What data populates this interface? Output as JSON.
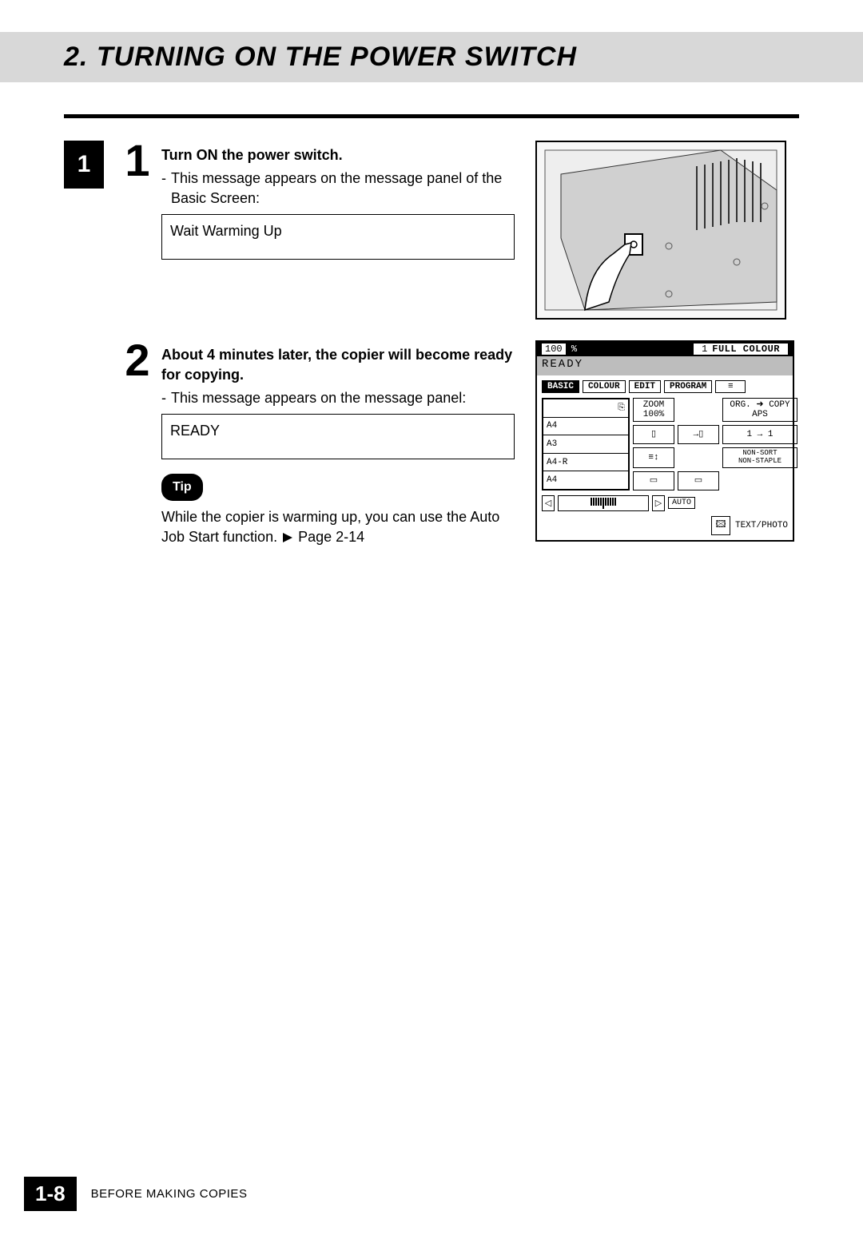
{
  "header": {
    "section_number": "2.",
    "title": "TURNING ON THE POWER SWITCH"
  },
  "side_tab": "1",
  "steps": [
    {
      "num": "1",
      "heading": "Turn ON the power switch.",
      "bullet": "This message appears on the message panel of the Basic Screen:",
      "message": "Wait  Warming Up"
    },
    {
      "num": "2",
      "heading": "About 4 minutes later, the copier will become ready for copying.",
      "bullet": "This message appears on the message panel:",
      "message": "READY"
    }
  ],
  "tip": {
    "label": "Tip",
    "text_before": "While the copier is warming up, you can use the Auto Job Start function.",
    "page_ref": "Page 2-14"
  },
  "lcd": {
    "percent": "100",
    "percent_sym": "%",
    "count": "1",
    "mode": "FULL COLOUR",
    "ready": "READY",
    "tabs": [
      "BASIC",
      "COLOUR",
      "EDIT",
      "PROGRAM"
    ],
    "papers": [
      "",
      "A4",
      "A3",
      "A4-R",
      "A4"
    ],
    "zoom_label": "ZOOM",
    "zoom_value": "100%",
    "orgcopy": "ORG. ➜ COPY",
    "aps": "APS",
    "ratio": "1 → 1",
    "nonsort": "NON-SORT",
    "nonstaple": "NON-STAPLE",
    "auto": "AUTO",
    "textphoto": "TEXT/PHOTO"
  },
  "footer": {
    "page": "1-8",
    "label": "BEFORE MAKING COPIES"
  }
}
